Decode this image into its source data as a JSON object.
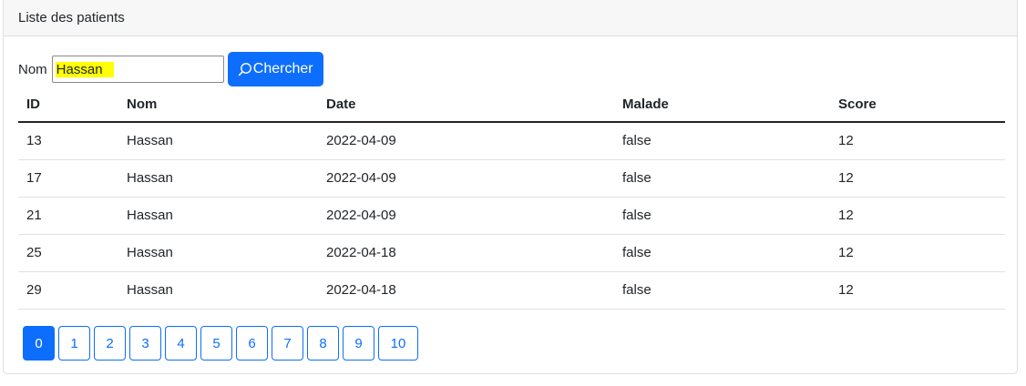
{
  "card": {
    "title": "Liste des patients"
  },
  "search": {
    "label": "Nom",
    "value": "Hassan",
    "button_label": "Chercher",
    "icon": "search-icon"
  },
  "table": {
    "headers": [
      "ID",
      "Nom",
      "Date",
      "Malade",
      "Score"
    ],
    "rows": [
      [
        "13",
        "Hassan",
        "2022-04-09",
        "false",
        "12"
      ],
      [
        "17",
        "Hassan",
        "2022-04-09",
        "false",
        "12"
      ],
      [
        "21",
        "Hassan",
        "2022-04-09",
        "false",
        "12"
      ],
      [
        "25",
        "Hassan",
        "2022-04-18",
        "false",
        "12"
      ],
      [
        "29",
        "Hassan",
        "2022-04-18",
        "false",
        "12"
      ]
    ]
  },
  "pagination": {
    "pages": [
      "0",
      "1",
      "2",
      "3",
      "4",
      "5",
      "6",
      "7",
      "8",
      "9",
      "10"
    ],
    "active": "0"
  },
  "colors": {
    "primary": "#0d6efd",
    "highlight": "#ffff00",
    "header_bg": "#f7f7f7"
  }
}
